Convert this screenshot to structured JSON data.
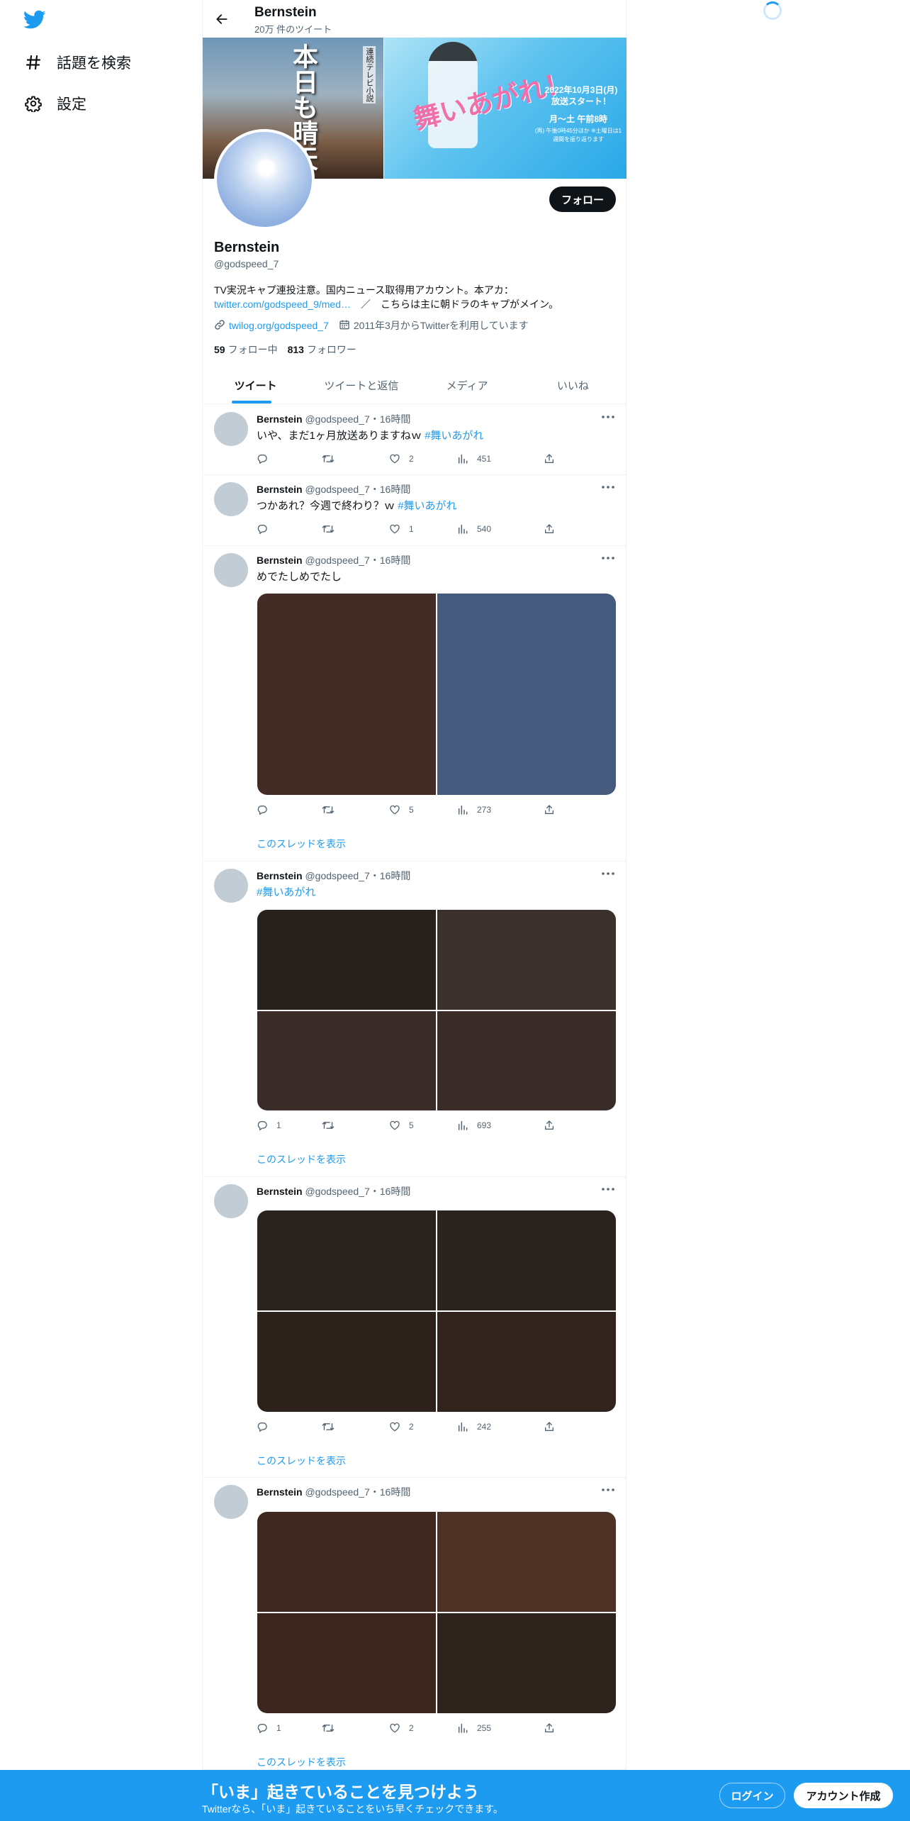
{
  "nav": {
    "logo_icon": "twitter-bird-icon",
    "items": [
      {
        "label": "話題を検索",
        "icon": "hashtag-icon"
      },
      {
        "label": "設定",
        "icon": "gear-icon"
      }
    ]
  },
  "header": {
    "name": "Bernstein",
    "tweet_count": "20万 件のツイート"
  },
  "banner": {
    "left_title": "本日も晴天",
    "left_sub": "連続テレビ小説",
    "right_title": "舞いあがれ！",
    "right_date": "2022年10月3日(月) 放送スタート！",
    "right_time": "月〜土 午前8時",
    "right_small": "(再) 午後0時45分ほか ※土曜日は1週間を振り返ります"
  },
  "profile": {
    "name": "Bernstein",
    "handle": "@godspeed_7",
    "bio_line1": "TV実況キャプ連投注意。国内ニュース取得用アカウント。本アカ：",
    "bio_link": "twitter.com/godspeed_9/med…",
    "bio_rest": "　／　こちらは主に朝ドラのキャプがメイン。",
    "website": "twilog.org/godspeed_7",
    "joined": "2011年3月からTwitterを利用しています",
    "following_count": "59",
    "following_label": "フォロー中",
    "followers_count": "813",
    "followers_label": "フォロワー",
    "follow_button": "フォロー"
  },
  "tabs": [
    "ツイート",
    "ツイートと返信",
    "メディア",
    "いいね"
  ],
  "tweets": [
    {
      "name": "Bernstein",
      "meta": "@godspeed_7・16時間",
      "text": "いや、まだ1ヶ月放送ありますねｗ",
      "hashtag": "#舞いあがれ",
      "replies": "",
      "likes": "2",
      "views": "451",
      "show_thread": ""
    },
    {
      "name": "Bernstein",
      "meta": "@godspeed_7・16時間",
      "text": "つかあれ？今週で終わり？ｗ",
      "hashtag": "#舞いあがれ",
      "replies": "",
      "likes": "1",
      "views": "540",
      "show_thread": ""
    },
    {
      "name": "Bernstein",
      "meta": "@godspeed_7・16時間",
      "text": "めでたしめでたし",
      "hashtag": "",
      "replies": "",
      "likes": "5",
      "views": "273",
      "show_thread": "このスレッドを表示",
      "media_colors": [
        "#432c25",
        "#465a7e"
      ]
    },
    {
      "name": "Bernstein",
      "meta": "@godspeed_7・16時間",
      "text": "",
      "hashtag": "#舞いあがれ",
      "replies": "1",
      "likes": "5",
      "views": "693",
      "show_thread": "このスレッドを表示",
      "media_colors": [
        "#26211d",
        "#3a302c",
        "#3a2c29",
        "#3a2c28"
      ]
    },
    {
      "name": "Bernstein",
      "meta": "@godspeed_7・16時間",
      "text": "",
      "hashtag": "",
      "replies": "",
      "likes": "2",
      "views": "242",
      "show_thread": "このスレッドを表示",
      "media_colors": [
        "#2a221d",
        "#2a221e",
        "#2d211c",
        "#32241d"
      ]
    },
    {
      "name": "Bernstein",
      "meta": "@godspeed_7・16時間",
      "text": "",
      "hashtag": "",
      "replies": "1",
      "likes": "2",
      "views": "255",
      "show_thread": "このスレッドを表示",
      "media_colors": [
        "#3f2820",
        "#4f3226",
        "#3d2620",
        "#2e231d"
      ]
    }
  ],
  "bottom_banner": {
    "title": "「いま」起きていることを見つけよう",
    "subtitle": "Twitterなら、「いま」起きていることをいち早くチェックできます。",
    "login": "ログイン",
    "signup": "アカウント作成"
  },
  "colors": {
    "accent": "#1d9bf0",
    "text": "#0f1419",
    "secondary": "#536471"
  }
}
